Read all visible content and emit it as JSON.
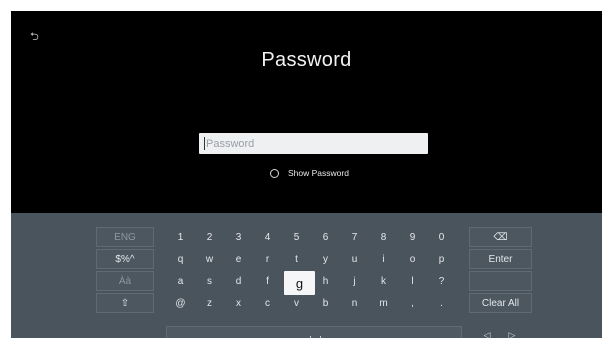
{
  "header": {
    "back_icon_glyph": "⮌",
    "title": "Password"
  },
  "password_field": {
    "placeholder": "Password",
    "value": ""
  },
  "show_password": {
    "label": "Show Password",
    "checked": false
  },
  "keyboard": {
    "left_keys": [
      "ENG",
      "$%^",
      "Àà",
      "⇧"
    ],
    "rows": [
      [
        "1",
        "2",
        "3",
        "4",
        "5",
        "6",
        "7",
        "8",
        "9",
        "0"
      ],
      [
        "q",
        "w",
        "e",
        "r",
        "t",
        "y",
        "u",
        "i",
        "o",
        "p"
      ],
      [
        "a",
        "s",
        "d",
        "f",
        "g",
        "h",
        "j",
        "k",
        "l",
        "?"
      ],
      [
        "@",
        "z",
        "x",
        "c",
        "v",
        "b",
        "n",
        "m",
        ",",
        "."
      ]
    ],
    "selected_key": "g",
    "right_keys": {
      "backspace_glyph": "⌫",
      "enter": "Enter",
      "clear_all": "Clear All"
    },
    "cursor_left_glyph": "◁",
    "cursor_right_glyph": "▷",
    "space_icon": "space-bar-icon"
  }
}
